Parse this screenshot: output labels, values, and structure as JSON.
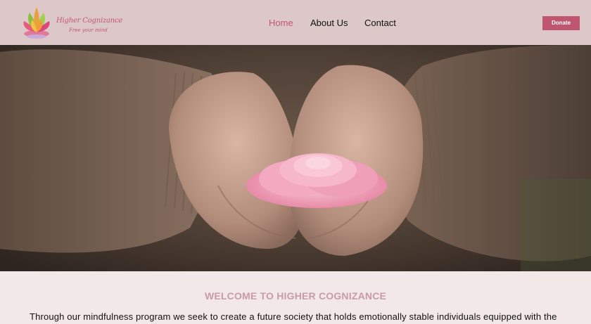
{
  "brand": {
    "name": "Higher Cognizance",
    "tagline": "Free your mind"
  },
  "nav": {
    "items": [
      {
        "label": "Home",
        "active": true
      },
      {
        "label": "About Us",
        "active": false
      },
      {
        "label": "Contact",
        "active": false
      }
    ]
  },
  "header": {
    "donate_label": "Donate"
  },
  "hero": {
    "image": "hands-holding-pink-flower"
  },
  "main": {
    "heading": "WELCOME TO HIGHER COGNIZANCE",
    "intro": "Through our mindfulness program we seek to create a future society that holds emotionally stable individuals equipped with the"
  },
  "colors": {
    "header_bg": "#dcc8c9",
    "accent": "#c25572",
    "heading": "#c99ba4",
    "page_bg": "#f3e8e8"
  }
}
